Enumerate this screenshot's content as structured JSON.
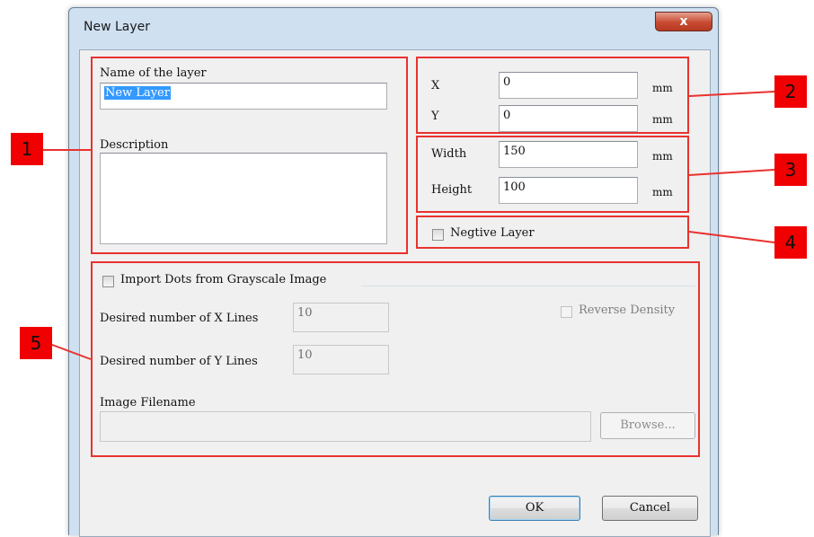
{
  "window": {
    "title": "New Layer",
    "close_glyph": "x"
  },
  "form": {
    "name_label": "Name of the layer",
    "name_value": "New Layer",
    "description_label": "Description",
    "description_value": "",
    "x_label": "X",
    "x_value": "0",
    "x_unit": "mm",
    "y_label": "Y",
    "y_value": "0",
    "y_unit": "mm",
    "width_label": "Width",
    "width_value": "150",
    "width_unit": "mm",
    "height_label": "Height",
    "height_value": "100",
    "height_unit": "mm",
    "negative_label": "Negtive Layer",
    "negative_checked": false
  },
  "import": {
    "checkbox_label": "Import Dots from Grayscale Image",
    "checked": false,
    "x_lines_label": "Desired number of X Lines",
    "x_lines_value": "10",
    "y_lines_label": "Desired number of Y Lines",
    "y_lines_value": "10",
    "reverse_label": "Reverse Density",
    "filename_label": "Image Filename",
    "filename_value": "",
    "browse_label": "Browse..."
  },
  "buttons": {
    "ok": "OK",
    "cancel": "Cancel"
  },
  "callouts": [
    "1",
    "2",
    "3",
    "4",
    "5"
  ],
  "colors": {
    "callout_red": "#f00000",
    "highlight_red": "#e8322f",
    "selection_blue": "#3399ff"
  }
}
